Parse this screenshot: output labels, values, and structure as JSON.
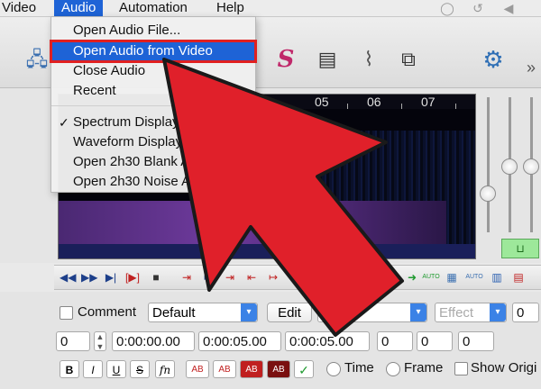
{
  "menubar": {
    "items": [
      "Video",
      "Audio",
      "Automation",
      "Help"
    ]
  },
  "audio_menu": {
    "items": [
      {
        "label": "Open Audio File...",
        "checked": false
      },
      {
        "label": "Open Audio from Video",
        "checked": false,
        "highlighted": true
      },
      {
        "label": "Close Audio",
        "checked": false
      },
      {
        "label": "Recent",
        "checked": false
      },
      {
        "label": "Spectrum Display",
        "checked": true
      },
      {
        "label": "Waveform Display",
        "checked": false
      },
      {
        "label": "Open 2h30 Blank Au",
        "checked": false
      },
      {
        "label": "Open 2h30 Noise Au",
        "checked": false
      }
    ]
  },
  "toolbar": {
    "icons": [
      "network-icon",
      "script-s-icon",
      "notes-icon",
      "paperclip-icon",
      "text-frame-icon",
      "gear-icon"
    ],
    "overflow_label": "»"
  },
  "spectrum": {
    "ruler_labels": [
      "05",
      "06",
      "07"
    ]
  },
  "transport": {
    "auto_labels": [
      "AUTO",
      "AUTO"
    ]
  },
  "properties": {
    "comment_label": "Comment",
    "style_value": "Default",
    "edit_label": "Edit",
    "actor_placeholder": "Actor",
    "effect_placeholder": "Effect",
    "margin_value": "0",
    "layer_value": "0",
    "start_time": "0:00:00.00",
    "end_time": "0:00:05.00",
    "duration": "0:00:05.00",
    "margin_l": "0",
    "margin_r": "0",
    "margin_v": "0",
    "format": {
      "bold": "B",
      "italic": "I",
      "underline": "U",
      "strike": "S",
      "fn": "fn",
      "ab": [
        "AB",
        "AB",
        "AB",
        "AB"
      ]
    },
    "time_label": "Time",
    "frame_label": "Frame",
    "show_original_label": "Show Origi"
  },
  "colors": {
    "accent_blue": "#1e63d6",
    "highlight_red": "#e02020",
    "arrow_red": "#e0202a"
  }
}
